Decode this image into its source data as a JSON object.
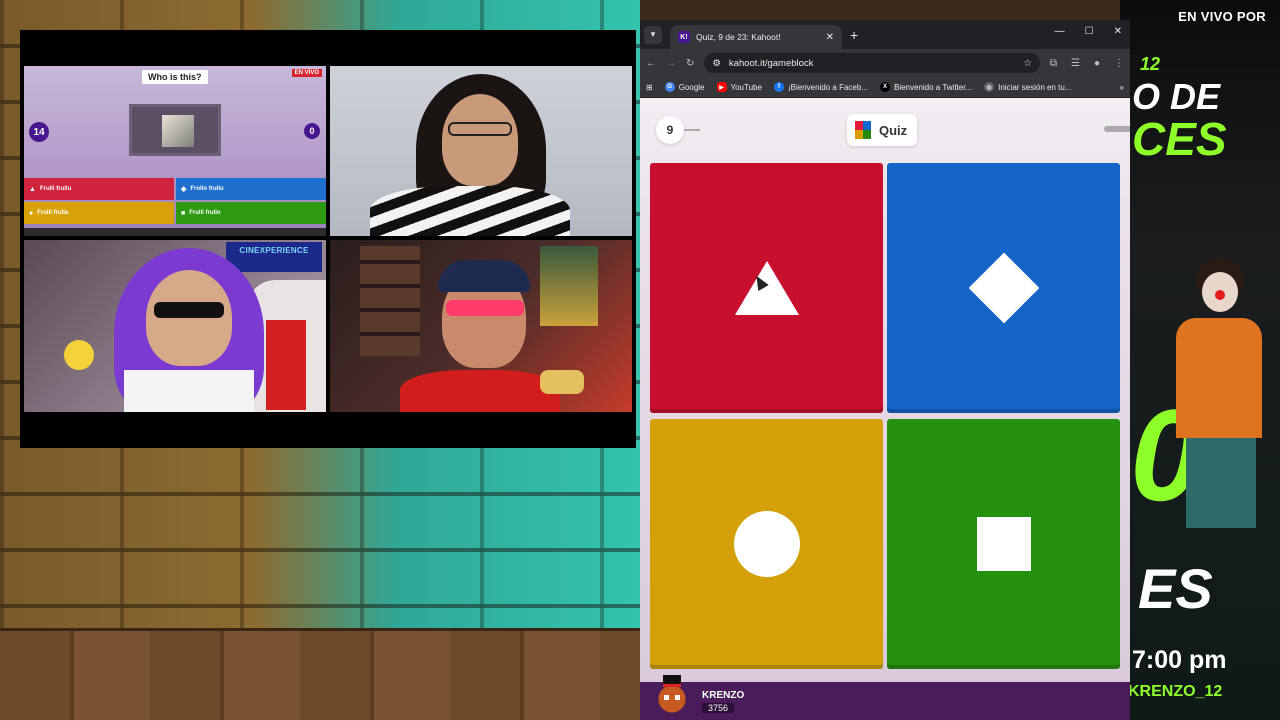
{
  "stream": {
    "kahoot_preview": {
      "question": "Who is this?",
      "live_badge": "EN VIVO",
      "timer": "14",
      "answers_count": "0",
      "answers": [
        {
          "symbol": "▲",
          "label": "Frulli frullu",
          "color": "red"
        },
        {
          "symbol": "◆",
          "label": "Frollo frullu",
          "color": "blue"
        },
        {
          "symbol": "●",
          "label": "Frulli frulla",
          "color": "yellow"
        },
        {
          "symbol": "■",
          "label": "Frulli frullo",
          "color": "green"
        }
      ]
    },
    "cam3_sign": "CINEXPERIENCE"
  },
  "poster": {
    "top": "EN VIVO POR",
    "big_lines": [
      "12",
      "O DE",
      "CES",
      "0",
      "ES"
    ],
    "time": "7:00 pm",
    "handle": "KRENZO_12"
  },
  "browser": {
    "tab": {
      "favicon": "K!",
      "title": "Quiz, 9 de 23: Kahoot!"
    },
    "url": "kahoot.it/gameblock",
    "bookmarks": [
      {
        "icon": "G",
        "label": "Google",
        "color": "#4285f4"
      },
      {
        "icon": "▶",
        "label": "YouTube",
        "color": "#ff0000"
      },
      {
        "icon": "f",
        "label": "¡Bienvenido a Faceb...",
        "color": "#1877f2"
      },
      {
        "icon": "X",
        "label": "Bienvenido a Twitter...",
        "color": "#000000"
      },
      {
        "icon": "◎",
        "label": "Iniciar sesión en tu...",
        "color": "#5f6368"
      }
    ]
  },
  "kahoot": {
    "question_number": "9",
    "quiz_label": "Quiz",
    "answer_shapes": [
      "triangle",
      "diamond",
      "circle",
      "square"
    ],
    "colors": {
      "red": "#c8102e",
      "blue": "#1565c8",
      "yellow": "#d4a00a",
      "green": "#26910f"
    },
    "player": {
      "name": "KRENZO",
      "score": "3756"
    }
  }
}
